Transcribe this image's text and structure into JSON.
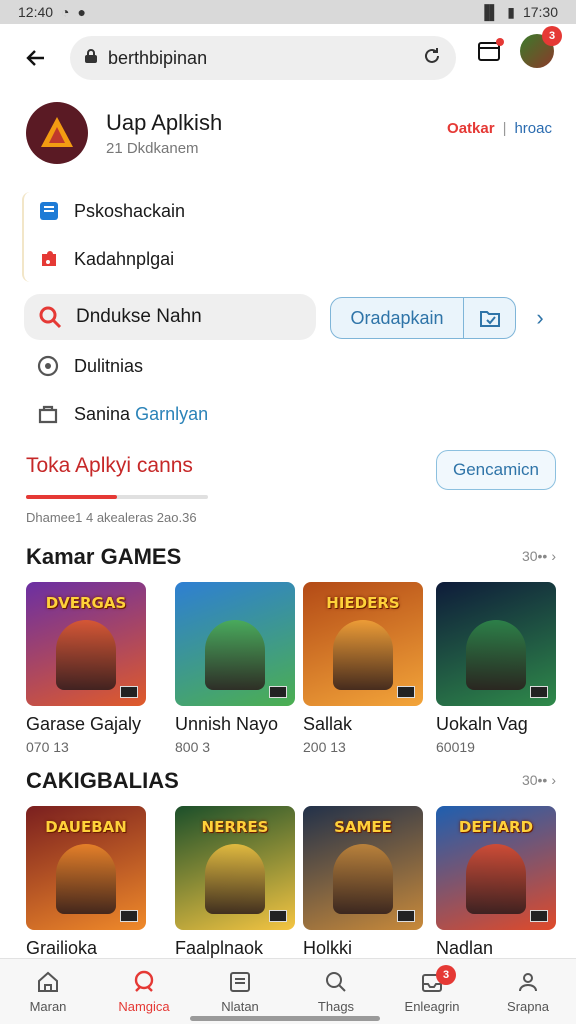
{
  "status": {
    "time_left": "12:40",
    "time_right": "17:30"
  },
  "browser": {
    "url": "berthbipinan",
    "tabs_badge": "",
    "avatar_badge": "3"
  },
  "app": {
    "name": "Uap Aplkish",
    "subtitle": "21 Dkdkanem",
    "brand_a": "Oatkar",
    "brand_b": "hroac"
  },
  "menu": [
    {
      "label": "Pskoshackain",
      "icon": "book-icon"
    },
    {
      "label": "Kadahnplgai",
      "icon": "puzzle-icon"
    }
  ],
  "search": {
    "placeholder": "Dndukse Nahn",
    "button_label": "Oradapkain"
  },
  "list": [
    {
      "label": "Dulitnias",
      "icon": "chat-icon"
    },
    {
      "label": "Sanina",
      "label_accent": "Garnlyan",
      "icon": "bag-icon"
    }
  ],
  "promo": {
    "title": "Toka Aplkyi canns",
    "button": "Gencamicn",
    "note": "Dhamee1 4 akealeras 2ao.36",
    "progress": 0.5
  },
  "sections": [
    {
      "title": "Kamar GAMES",
      "more": "30••",
      "cards": [
        {
          "name": "Garase Gajaly",
          "count": "070 13",
          "thumb_text": "DVERGAS",
          "colors": [
            "#6b2fa3",
            "#e05b2a"
          ]
        },
        {
          "name": "Unnish Nayo",
          "count": "800 3",
          "thumb_text": "",
          "colors": [
            "#2e7fd3",
            "#4caf50"
          ]
        },
        {
          "name": "Sallak",
          "count": "200 13",
          "thumb_text": "HIEDERS",
          "colors": [
            "#b34a16",
            "#f3a53a"
          ]
        },
        {
          "name": "Uokaln Vag",
          "count": "60019",
          "thumb_text": "",
          "colors": [
            "#0e1b3a",
            "#2f8a4a"
          ]
        }
      ]
    },
    {
      "title": "CAKIGBALIAS",
      "more": "30••",
      "cards": [
        {
          "name": "Grailioka",
          "count": "",
          "thumb_text": "DAUEBAN",
          "colors": [
            "#7a1f1f",
            "#f08a2a"
          ]
        },
        {
          "name": "Faalplnaok",
          "count": "",
          "thumb_text": "NERRES",
          "colors": [
            "#1b4f2a",
            "#f5c542"
          ]
        },
        {
          "name": "Holkki",
          "count": "",
          "thumb_text": "SAMEE",
          "colors": [
            "#22314a",
            "#c98a3a"
          ]
        },
        {
          "name": "Nadlan",
          "count": "",
          "thumb_text": "DEFIARD",
          "colors": [
            "#1e5fb0",
            "#e04a2a"
          ]
        }
      ]
    }
  ],
  "nav": [
    {
      "label": "Maran",
      "icon": "home-icon",
      "active": false
    },
    {
      "label": "Namgica",
      "icon": "game-icon",
      "active": true
    },
    {
      "label": "Nlatan",
      "icon": "list-icon",
      "active": false
    },
    {
      "label": "Thags",
      "icon": "search-icon",
      "active": false
    },
    {
      "label": "Enleagrin",
      "icon": "inbox-icon",
      "active": false,
      "badge": "3"
    },
    {
      "label": "Srapna",
      "icon": "person-icon",
      "active": false
    }
  ]
}
